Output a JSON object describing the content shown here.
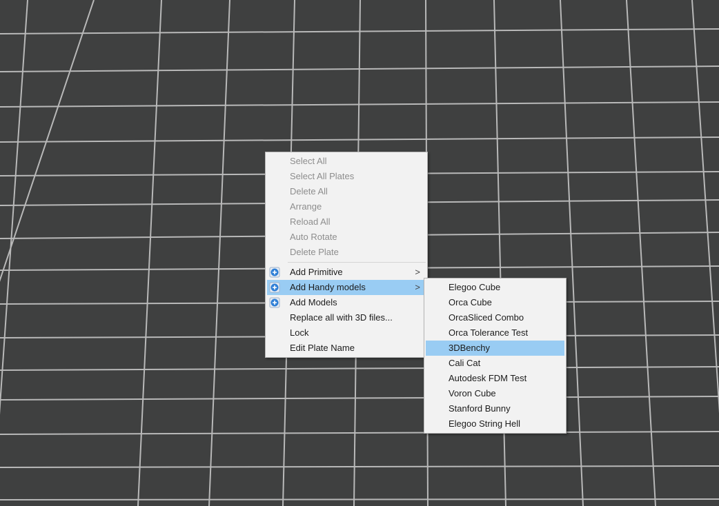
{
  "viewport": {
    "background": "#3f4040",
    "grid_color": "#b9b9b9"
  },
  "context_menu": {
    "group1": [
      {
        "label": "Select All",
        "enabled": false
      },
      {
        "label": "Select All Plates",
        "enabled": false
      },
      {
        "label": "Delete All",
        "enabled": false
      },
      {
        "label": "Arrange",
        "enabled": false
      },
      {
        "label": "Reload All",
        "enabled": false
      },
      {
        "label": "Auto Rotate",
        "enabled": false
      },
      {
        "label": "Delete Plate",
        "enabled": false
      }
    ],
    "group2": [
      {
        "label": "Add Primitive",
        "icon": "add-circle-icon",
        "has_submenu": true,
        "submenu_indicator": ">"
      },
      {
        "label": "Add Handy models",
        "icon": "add-circle-icon",
        "has_submenu": true,
        "submenu_indicator": ">",
        "highlighted": true
      },
      {
        "label": "Add Models",
        "icon": "add-circle-icon"
      },
      {
        "label": "Replace all with 3D files..."
      },
      {
        "label": "Lock"
      },
      {
        "label": "Edit Plate Name"
      }
    ]
  },
  "handy_models_submenu": {
    "items": [
      {
        "label": "Elegoo Cube"
      },
      {
        "label": "Orca Cube"
      },
      {
        "label": "OrcaSliced Combo"
      },
      {
        "label": "Orca Tolerance Test"
      },
      {
        "label": "3DBenchy",
        "highlighted": true
      },
      {
        "label": "Cali Cat"
      },
      {
        "label": "Autodesk FDM Test"
      },
      {
        "label": "Voron Cube"
      },
      {
        "label": "Stanford Bunny"
      },
      {
        "label": "Elegoo String Hell"
      }
    ],
    "highlight_color": "#99ccf3"
  }
}
